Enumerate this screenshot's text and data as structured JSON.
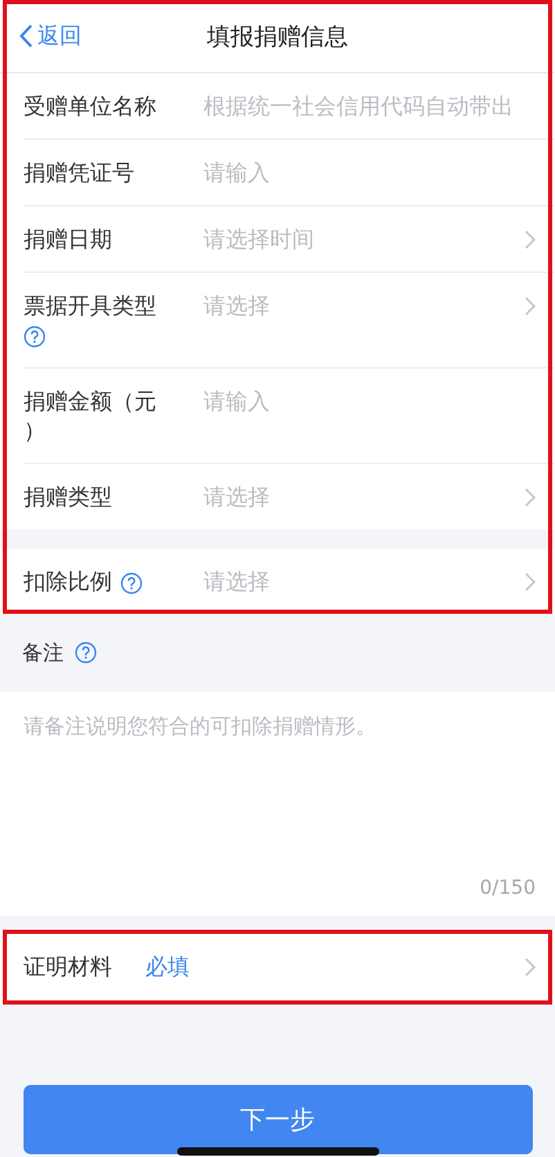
{
  "nav": {
    "back_label": "返回",
    "title": "填报捐赠信息"
  },
  "form": {
    "highlighted": true,
    "sections": [
      {
        "fields": [
          {
            "label": "受赠单位名称",
            "placeholder": "根据统一社会信用代码自动带出",
            "kind": "text",
            "help": false
          },
          {
            "label": "捐赠凭证号",
            "placeholder": "请输入",
            "kind": "text",
            "help": false
          },
          {
            "label": "捐赠日期",
            "placeholder": "请选择时间",
            "kind": "select",
            "help": false
          },
          {
            "label": "票据开具类型",
            "placeholder": "请选择",
            "kind": "select",
            "help": true
          },
          {
            "label": "捐赠金额（元）",
            "placeholder": "请输入",
            "kind": "text",
            "help": false
          },
          {
            "label": "捐赠类型",
            "placeholder": "请选择",
            "kind": "select",
            "help": false
          }
        ]
      },
      {
        "fields": [
          {
            "label": "扣除比例",
            "placeholder": "请选择",
            "kind": "select",
            "help": true
          }
        ]
      }
    ]
  },
  "remark": {
    "label": "备注",
    "help": true,
    "placeholder": "请备注说明您符合的可扣除捐赠情形。",
    "counter": "0/150"
  },
  "proof": {
    "label": "证明材料",
    "value": "必填",
    "highlighted": true
  },
  "next_button": "下一步"
}
